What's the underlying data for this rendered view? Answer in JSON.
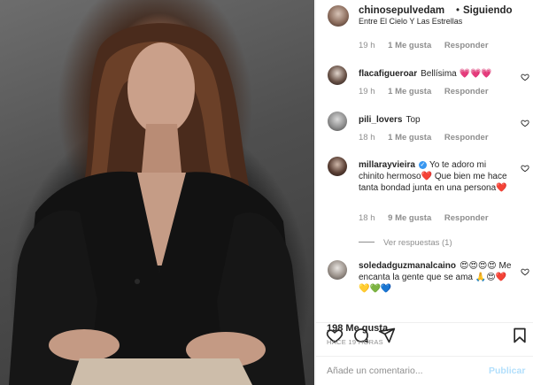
{
  "post": {
    "username": "chinosepulvedam",
    "separator": "•",
    "follow_status": "Siguiendo",
    "location": "Entre El Cielo Y Las Estrellas"
  },
  "comments": [
    {
      "time": "19 h",
      "likes": "1 Me gusta",
      "reply": "Responder"
    },
    {
      "username": "flacafigueroar",
      "text": "Bellísima",
      "emoji": "💗💗💗",
      "time": "19 h",
      "likes": "1 Me gusta",
      "reply": "Responder"
    },
    {
      "username": "pili_lovers",
      "text": "Top",
      "time": "18 h",
      "likes": "1 Me gusta",
      "reply": "Responder"
    },
    {
      "username": "millarayvieira",
      "verified_mark": "✓",
      "text_1": "Yo te adoro mi chinito hermoso",
      "heart_1": "❤️",
      "text_2": " Que bien me hace tanta bondad junta en una persona",
      "heart_2": "❤️",
      "time": "18 h",
      "likes": "9 Me gusta",
      "reply": "Responder",
      "view_replies": "Ver respuestas (1)"
    },
    {
      "username": "soledadguzmanalcaino",
      "emoji_prefix": "😍😍😍😍",
      "text": "Me encanta la gente que se ama",
      "emoji_suffix": "🙏😍❤️💛💚💙"
    }
  ],
  "actions": {
    "likes_count": "198 Me gusta",
    "posted_ago": "HACE 19 HORAS"
  },
  "add_comment": {
    "placeholder": "Añade un comentario...",
    "publish_label": "Publicar"
  },
  "colors": {
    "link_blue_disabled": "#b2dffc",
    "verified_blue": "#3897f0",
    "muted_text": "#8e8e8e"
  },
  "icons": [
    "heart-icon",
    "comment-icon",
    "share-icon",
    "bookmark-icon",
    "verified-badge-icon"
  ]
}
